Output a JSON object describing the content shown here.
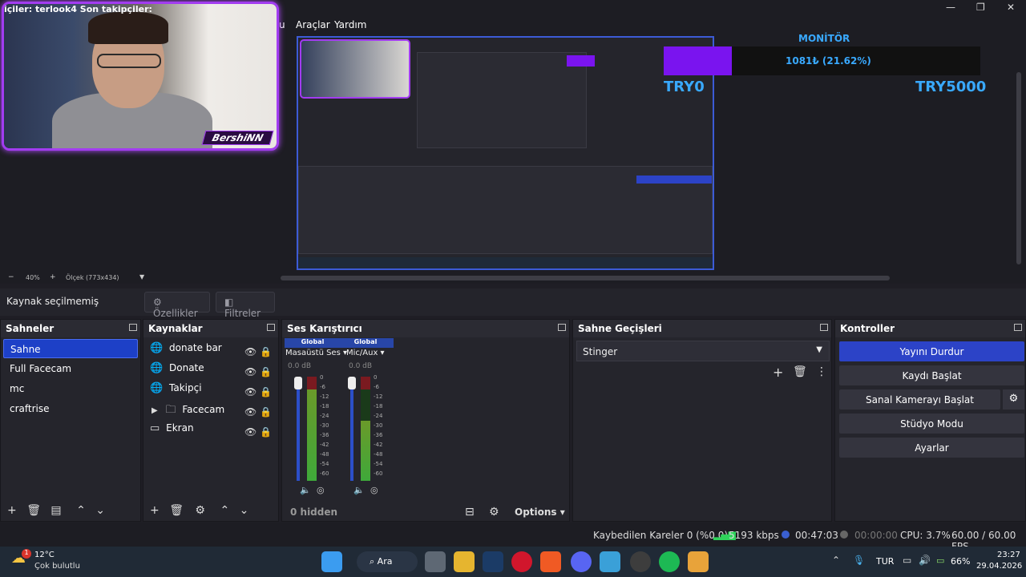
{
  "overlay": {
    "followers_text": "içiler: terlook4   Son takipçiler:",
    "facecam_label": "BershiNN"
  },
  "menu": {
    "items": [
      "u",
      "Araçlar",
      "Yardım"
    ]
  },
  "window_controls": {
    "minimize": "—",
    "maximize": "❐",
    "close": "✕"
  },
  "monitor": {
    "title": "MONİTÖR",
    "value_text": "1081₺ (21.62%)",
    "progress_fraction": 0.2162,
    "min_label": "TRY0",
    "max_label": "TRY5000"
  },
  "zoom": {
    "minus": "−",
    "percent": "40%",
    "plus": "+",
    "scale": "Ölçek (773x434)"
  },
  "source_bar": {
    "status": "Kaynak seçilmemiş",
    "properties": "Özellikler",
    "filters": "Filtreler"
  },
  "scenes": {
    "title": "Sahneler",
    "items": [
      "Sahne",
      "Full Facecam",
      "mc",
      "craftrise"
    ],
    "selected_index": 0
  },
  "sources": {
    "title": "Kaynaklar",
    "items": [
      {
        "name": "donate bar",
        "icon": "globe-icon"
      },
      {
        "name": "Donate",
        "icon": "globe-icon"
      },
      {
        "name": "Takipçi",
        "icon": "globe-icon"
      },
      {
        "name": "Facecam",
        "icon": "folder-icon"
      },
      {
        "name": "Ekran",
        "icon": "monitor-icon"
      }
    ]
  },
  "mixer": {
    "title": "Ses Karıştırıcı",
    "channels": [
      {
        "badge": "Global",
        "name": "Masaüstü Ses",
        "db": "0.0 dB",
        "level": 0.12
      },
      {
        "badge": "Global",
        "name": "Mic/Aux",
        "db": "0.0 dB",
        "level": 0.42
      }
    ],
    "scale": [
      "0",
      "-6",
      "-12",
      "-18",
      "-24",
      "-30",
      "-36",
      "-42",
      "-48",
      "-54",
      "-60"
    ],
    "hidden": "0 hidden",
    "options": "Options"
  },
  "transitions": {
    "title": "Sahne Geçişleri",
    "selected": "Stinger"
  },
  "controls": {
    "title": "Kontroller",
    "stream": "Yayını Durdur",
    "record": "Kaydı Başlat",
    "virtual_cam": "Sanal Kamerayı Başlat",
    "studio": "Stüdyo Modu",
    "settings": "Ayarlar",
    "accent": "#2c43c7"
  },
  "status": {
    "dropped": "Kaybedilen Kareler 0 (%0.0)",
    "bitrate": "5193 kbps",
    "stream_time": "00:47:03",
    "record_time": "00:00:00",
    "cpu": "CPU: 3.7%",
    "fps": "60.00 / 60.00 FPS"
  },
  "taskbar": {
    "weather_temp": "12°C",
    "weather_desc": "Çok bulutlu",
    "weather_badge": "1",
    "search": "Ara",
    "lang": "TUR",
    "battery": "66%",
    "time": "23:27",
    "date": "29.04.2026"
  }
}
